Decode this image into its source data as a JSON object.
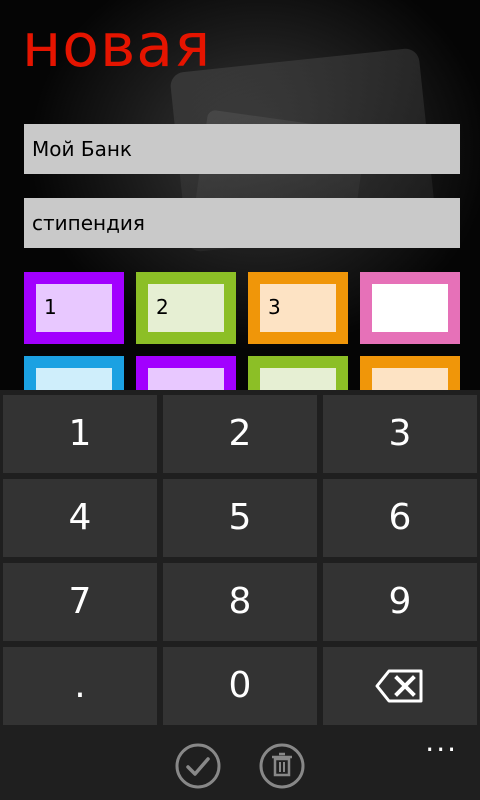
{
  "page": {
    "title": "новая"
  },
  "fields": {
    "bank": "Мой Банк",
    "category": "стипендия"
  },
  "tiles": [
    {
      "label": "1",
      "border": "#a200ff",
      "fill": "#e8c8ff"
    },
    {
      "label": "2",
      "border": "#8cbf26",
      "fill": "#e6efd3"
    },
    {
      "label": "3",
      "border": "#f09609",
      "fill": "#fde3c4"
    },
    {
      "label": "",
      "border": "#e671b8",
      "fill": "#ffffff"
    },
    {
      "label": "",
      "border": "#1ba1e2",
      "fill": "#cfeefb"
    },
    {
      "label": "",
      "border": "#a200ff",
      "fill": "#e8c8ff"
    },
    {
      "label": "",
      "border": "#8cbf26",
      "fill": "#e6efd3"
    },
    {
      "label": "",
      "border": "#f09609",
      "fill": "#fde3c4"
    }
  ],
  "keypad": {
    "keys": [
      "1",
      "2",
      "3",
      "4",
      "5",
      "6",
      "7",
      "8",
      "9",
      ".",
      "0"
    ],
    "backspace_icon": "backspace-icon"
  },
  "appbar": {
    "icons": [
      "check-icon",
      "trash-icon"
    ],
    "more": "..."
  },
  "colors": {
    "accent": "#e51400"
  }
}
